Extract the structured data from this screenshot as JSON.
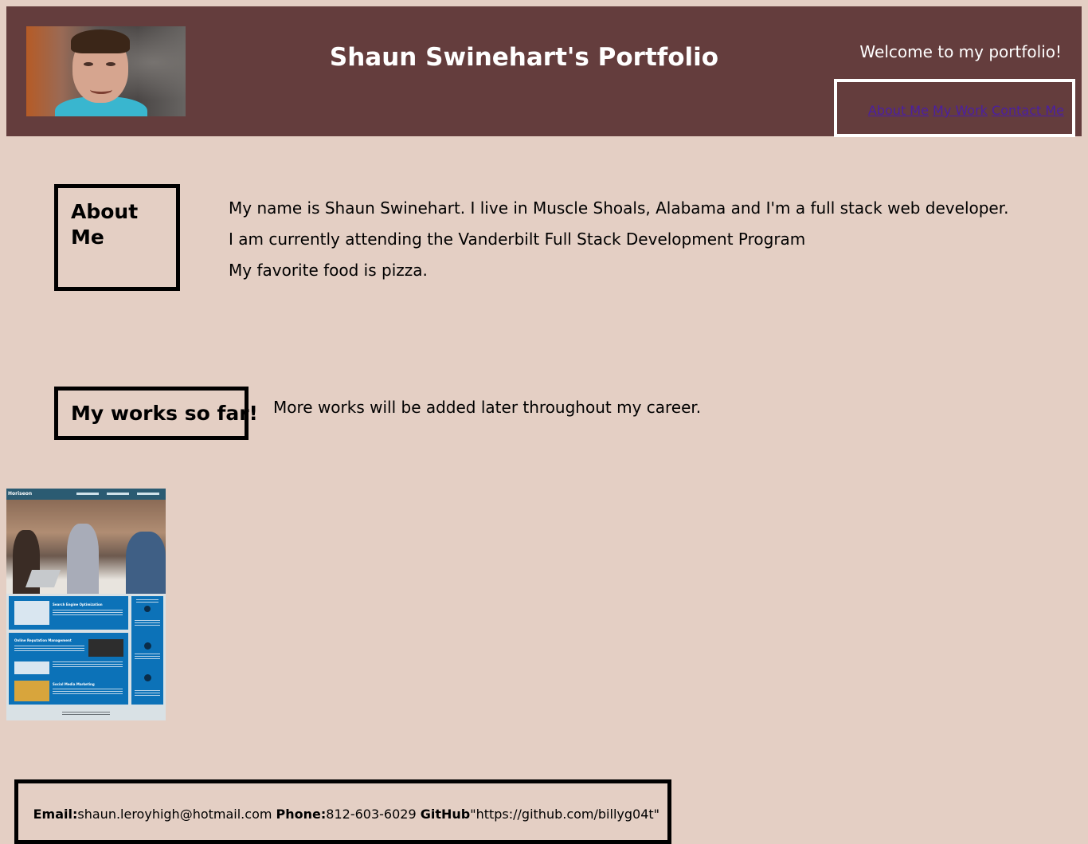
{
  "header": {
    "title": "Shaun Swinehart's Portfolio",
    "welcome": "Welcome to my portfolio!",
    "nav": [
      {
        "label": "About Me"
      },
      {
        "label": "My Work"
      },
      {
        "label": "Contact Me"
      }
    ]
  },
  "about": {
    "heading": "About Me",
    "lines": [
      "My name is Shaun Swinehart. I live in Muscle Shoals, Alabama and I'm a full stack web developer.",
      "I am currently attending the Vanderbilt Full Stack Development Program",
      "My favorite food is pizza."
    ]
  },
  "works": {
    "heading": "My works so far!",
    "note": "More works will be added later throughout my career.",
    "thumbnail": {
      "brand": "Horiseon",
      "sections": [
        "Search Engine Optimization",
        "Online Reputation Management",
        "Social Media Marketing"
      ]
    }
  },
  "contact": {
    "email_label": "Email:",
    "email": "shaun.leroyhigh@hotmail.com",
    "phone_label": "Phone:",
    "phone": "812-603-6029",
    "github_label": "GitHub",
    "github": "\"https://github.com/billyg04t\""
  },
  "colors": {
    "page_background": "#e4cfc4",
    "header_background": "#643d3d",
    "link": "#4b1fa3"
  }
}
